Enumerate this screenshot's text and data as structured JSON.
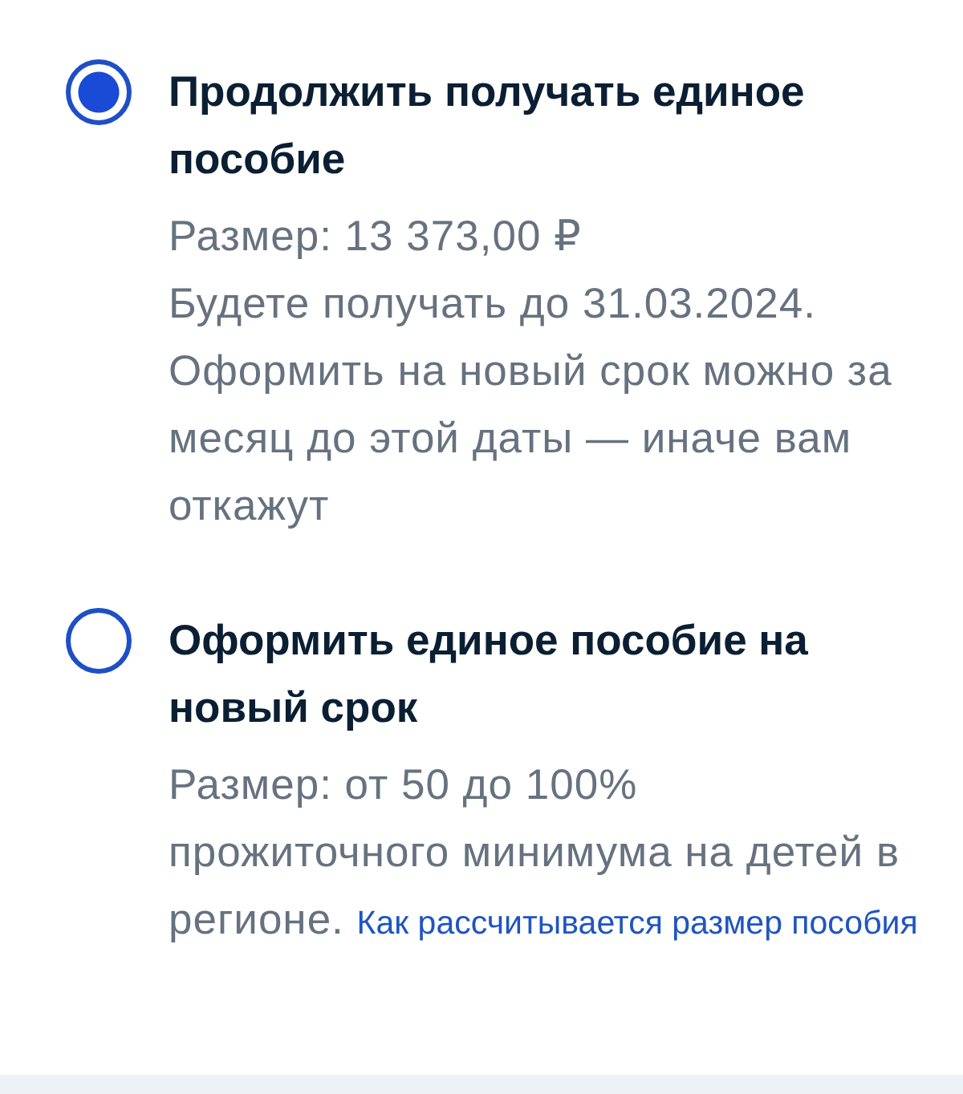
{
  "options": [
    {
      "title": "Продолжить получать единое пособие",
      "selected": true,
      "details": [
        {
          "text": "Размер: 13 373,00 ₽"
        },
        {
          "text": "Будете получать до 31.03.2024. Оформить на новый срок можно за месяц до этой даты — иначе вам откажут"
        }
      ]
    },
    {
      "title": "Оформить единое пособие на новый срок",
      "selected": false,
      "details": [
        {
          "text": "Размер: от 50 до 100%"
        },
        {
          "text": "прожиточного минимума на детей в регионе.",
          "link": "Как рассчитывается размер пособия"
        }
      ]
    }
  ]
}
